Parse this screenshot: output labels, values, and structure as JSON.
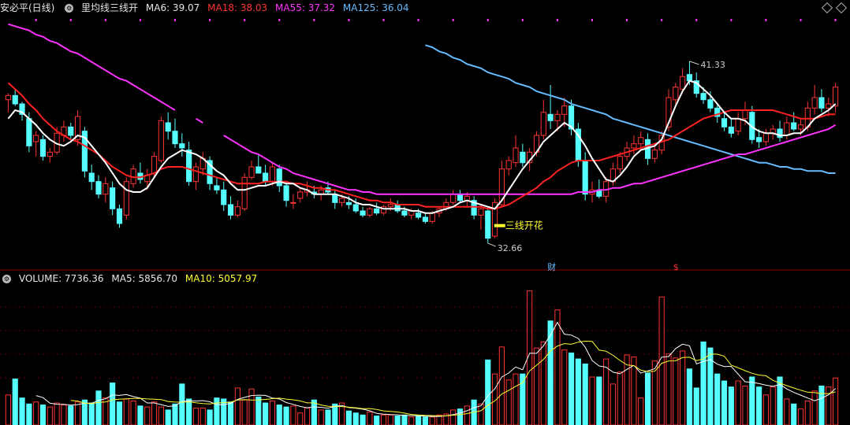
{
  "header": {
    "stock_name": "安必平(日线)",
    "indicator_name": "里均线三线开",
    "ma6": "MA6: 39.07",
    "ma18": "MA18: 38.03",
    "ma55": "MA55: 37.32",
    "ma125": "MA125: 36.04"
  },
  "volume_header": {
    "volume": "VOLUME: 7736.36",
    "ma5": "MA5: 5856.70",
    "ma10": "MA10: 5057.97"
  },
  "annotations": {
    "high_label": "41.33",
    "low_label": "32.66",
    "signal_text": "三线开花",
    "finance_badge": "财",
    "dollar_badge": "$"
  },
  "colors": {
    "up": "#ff3333",
    "down": "#55ffff",
    "ma6": "#ffffff",
    "ma18": "#ff2222",
    "ma55": "#ff33ff",
    "ma125": "#66bbff",
    "vol_ma5": "#ffffff",
    "vol_ma10": "#ffff33"
  },
  "chart_data": {
    "type": "candlestick",
    "price_range": [
      31.5,
      43.5
    ],
    "volume_max": 14000,
    "candles": [
      [
        39.5,
        39.8,
        38.9,
        39.7
      ],
      [
        39.7,
        40.0,
        39.2,
        39.3
      ],
      [
        39.3,
        39.4,
        38.5,
        38.8
      ],
      [
        38.6,
        38.9,
        37.0,
        37.3
      ],
      [
        37.5,
        38.0,
        36.8,
        37.8
      ],
      [
        37.6,
        37.8,
        36.6,
        36.8
      ],
      [
        36.8,
        37.2,
        36.5,
        37.0
      ],
      [
        37.0,
        38.2,
        36.9,
        37.9
      ],
      [
        37.8,
        38.5,
        37.5,
        38.2
      ],
      [
        38.2,
        38.4,
        37.6,
        37.8
      ],
      [
        37.6,
        39.0,
        37.3,
        38.7
      ],
      [
        38.0,
        38.2,
        35.8,
        36.1
      ],
      [
        36.0,
        36.4,
        35.2,
        35.6
      ],
      [
        35.6,
        35.9,
        34.8,
        35.0
      ],
      [
        35.0,
        35.8,
        34.6,
        35.5
      ],
      [
        35.3,
        35.6,
        34.0,
        34.3
      ],
      [
        34.3,
        34.5,
        33.4,
        33.6
      ],
      [
        34.0,
        35.8,
        33.8,
        35.6
      ],
      [
        35.5,
        36.4,
        35.3,
        36.2
      ],
      [
        36.0,
        36.5,
        35.5,
        35.7
      ],
      [
        35.6,
        36.2,
        35.2,
        35.9
      ],
      [
        36.0,
        37.0,
        35.8,
        36.8
      ],
      [
        36.6,
        38.7,
        36.5,
        38.5
      ],
      [
        38.4,
        38.9,
        37.6,
        38.0
      ],
      [
        38.0,
        38.6,
        37.2,
        37.4
      ],
      [
        37.4,
        37.9,
        36.8,
        37.2
      ],
      [
        37.1,
        37.5,
        35.4,
        35.6
      ],
      [
        35.6,
        36.5,
        35.2,
        36.3
      ],
      [
        36.2,
        37.0,
        35.9,
        36.7
      ],
      [
        36.6,
        36.8,
        35.2,
        35.5
      ],
      [
        35.4,
        35.8,
        35.0,
        35.2
      ],
      [
        35.2,
        35.6,
        34.2,
        34.5
      ],
      [
        34.5,
        34.9,
        33.8,
        34.0
      ],
      [
        34.0,
        34.7,
        33.9,
        34.4
      ],
      [
        34.3,
        36.0,
        34.2,
        35.8
      ],
      [
        35.8,
        36.6,
        35.7,
        36.3
      ],
      [
        36.3,
        36.9,
        36.0,
        36.0
      ],
      [
        36.0,
        36.4,
        35.4,
        35.6
      ],
      [
        35.6,
        36.5,
        35.4,
        36.3
      ],
      [
        36.2,
        36.4,
        35.1,
        35.4
      ],
      [
        35.4,
        35.6,
        34.4,
        34.7
      ],
      [
        34.6,
        35.0,
        34.3,
        34.6
      ],
      [
        34.8,
        35.3,
        34.6,
        35.1
      ],
      [
        35.1,
        35.6,
        34.9,
        35.2
      ],
      [
        35.1,
        35.4,
        34.8,
        35.0
      ],
      [
        35.0,
        35.4,
        34.7,
        35.2
      ],
      [
        35.3,
        35.6,
        35.0,
        35.1
      ],
      [
        35.0,
        35.2,
        34.3,
        34.6
      ],
      [
        34.6,
        35.0,
        34.4,
        34.8
      ],
      [
        34.6,
        34.9,
        34.3,
        34.5
      ],
      [
        34.5,
        34.8,
        34.1,
        34.2
      ],
      [
        34.2,
        34.4,
        33.9,
        34.0
      ],
      [
        34.0,
        34.4,
        33.9,
        34.3
      ],
      [
        34.3,
        34.6,
        34.0,
        34.1
      ],
      [
        34.1,
        34.5,
        34.0,
        34.4
      ],
      [
        34.4,
        34.8,
        34.2,
        34.5
      ],
      [
        34.5,
        34.7,
        34.1,
        34.2
      ],
      [
        34.2,
        34.4,
        33.9,
        34.0
      ],
      [
        34.0,
        34.3,
        33.8,
        34.2
      ],
      [
        34.1,
        34.3,
        33.8,
        33.9
      ],
      [
        33.9,
        34.1,
        33.6,
        33.7
      ],
      [
        33.7,
        34.2,
        33.6,
        34.1
      ],
      [
        34.1,
        34.4,
        33.9,
        34.3
      ],
      [
        34.3,
        34.8,
        34.2,
        34.6
      ],
      [
        34.6,
        35.2,
        34.5,
        35.0
      ],
      [
        35.0,
        35.2,
        34.6,
        34.7
      ],
      [
        34.7,
        35.1,
        34.4,
        34.9
      ],
      [
        34.7,
        34.9,
        33.8,
        34.0
      ],
      [
        34.0,
        34.5,
        33.3,
        34.3
      ],
      [
        34.2,
        34.4,
        32.66,
        32.9
      ],
      [
        33.0,
        34.8,
        32.9,
        34.6
      ],
      [
        34.5,
        36.6,
        34.4,
        36.2
      ],
      [
        36.2,
        36.8,
        35.9,
        36.6
      ],
      [
        36.5,
        37.8,
        36.3,
        37.2
      ],
      [
        37.0,
        37.4,
        36.3,
        36.5
      ],
      [
        36.5,
        37.2,
        36.1,
        37.0
      ],
      [
        37.0,
        38.0,
        36.8,
        37.8
      ],
      [
        37.8,
        39.5,
        37.6,
        38.9
      ],
      [
        38.8,
        40.2,
        38.1,
        38.5
      ],
      [
        38.5,
        39.0,
        38.0,
        38.8
      ],
      [
        38.8,
        39.6,
        38.2,
        39.2
      ],
      [
        39.2,
        39.5,
        37.8,
        38.1
      ],
      [
        38.1,
        38.4,
        36.3,
        36.6
      ],
      [
        36.6,
        37.0,
        34.7,
        35.0
      ],
      [
        35.0,
        35.6,
        34.6,
        35.2
      ],
      [
        35.2,
        35.7,
        34.8,
        34.9
      ],
      [
        34.9,
        35.8,
        34.6,
        35.6
      ],
      [
        35.6,
        36.5,
        35.4,
        36.2
      ],
      [
        36.2,
        37.0,
        36.0,
        36.8
      ],
      [
        36.8,
        37.5,
        36.6,
        37.2
      ],
      [
        37.2,
        37.8,
        36.9,
        37.4
      ],
      [
        37.4,
        38.0,
        37.1,
        37.7
      ],
      [
        37.6,
        37.9,
        36.4,
        36.7
      ],
      [
        36.7,
        37.3,
        36.5,
        37.1
      ],
      [
        37.1,
        38.0,
        36.9,
        37.8
      ],
      [
        38.2,
        40.0,
        38.0,
        39.6
      ],
      [
        39.5,
        40.3,
        39.3,
        40.1
      ],
      [
        40.0,
        41.0,
        39.8,
        40.6
      ],
      [
        40.7,
        41.33,
        40.2,
        40.4
      ],
      [
        40.4,
        40.8,
        39.6,
        39.8
      ],
      [
        39.8,
        40.1,
        39.3,
        39.5
      ],
      [
        39.5,
        39.9,
        38.9,
        39.1
      ],
      [
        39.1,
        39.3,
        38.4,
        38.7
      ],
      [
        38.6,
        38.9,
        38.0,
        38.2
      ],
      [
        38.2,
        38.6,
        37.7,
        37.9
      ],
      [
        38.0,
        38.9,
        37.8,
        38.6
      ],
      [
        38.6,
        39.4,
        38.3,
        39.0
      ],
      [
        38.9,
        39.2,
        37.4,
        37.6
      ],
      [
        37.7,
        38.1,
        37.2,
        37.5
      ],
      [
        37.5,
        38.1,
        37.3,
        37.9
      ],
      [
        37.9,
        38.3,
        37.6,
        38.1
      ],
      [
        38.1,
        38.5,
        37.5,
        37.7
      ],
      [
        37.8,
        38.7,
        37.6,
        38.4
      ],
      [
        38.4,
        38.9,
        38.0,
        38.1
      ],
      [
        38.1,
        38.6,
        37.8,
        38.3
      ],
      [
        38.2,
        39.4,
        38.0,
        39.1
      ],
      [
        39.1,
        40.2,
        38.8,
        39.6
      ],
      [
        39.6,
        40.0,
        38.9,
        39.1
      ],
      [
        39.1,
        39.6,
        38.7,
        39.3
      ],
      [
        39.2,
        40.3,
        38.9,
        40.1
      ]
    ],
    "ma6": [
      38.6,
      39.0,
      38.9,
      38.6,
      38.3,
      37.9,
      37.6,
      37.4,
      37.3,
      37.5,
      37.8,
      37.7,
      37.3,
      36.9,
      36.5,
      36.0,
      35.5,
      35.2,
      35.1,
      35.1,
      35.3,
      35.8,
      36.3,
      36.7,
      36.9,
      37.1,
      37.0,
      36.9,
      36.7,
      36.4,
      36.1,
      35.9,
      35.5,
      35.2,
      35.2,
      35.3,
      35.4,
      35.4,
      35.5,
      35.6,
      35.5,
      35.5,
      35.3,
      35.2,
      35.0,
      35.0,
      35.0,
      35.0,
      34.9,
      34.8,
      34.6,
      34.5,
      34.5,
      34.4,
      34.3,
      34.3,
      34.3,
      34.3,
      34.2,
      34.2,
      34.1,
      34.1,
      34.2,
      34.3,
      34.4,
      34.6,
      34.7,
      34.6,
      34.5,
      34.4,
      34.3,
      34.7,
      35.2,
      35.7,
      36.2,
      36.6,
      37.0,
      37.5,
      37.8,
      38.1,
      38.4,
      38.2,
      37.8,
      37.3,
      36.7,
      36.2,
      35.7,
      35.6,
      35.9,
      36.3,
      36.8,
      37.1,
      37.2,
      37.3,
      37.6,
      38.4,
      39.2,
      39.9,
      40.4,
      40.3,
      40.0,
      39.7,
      39.3,
      38.9,
      38.6,
      38.6,
      38.5,
      38.2,
      38.0,
      37.9,
      37.9,
      37.8,
      37.8,
      37.9,
      37.9,
      38.2,
      38.6,
      38.8,
      39.0,
      39.3
    ],
    "ma18": [
      40.3,
      40.0,
      39.7,
      39.3,
      39.0,
      38.6,
      38.3,
      38.0,
      37.8,
      37.6,
      37.5,
      37.3,
      37.1,
      36.9,
      36.6,
      36.3,
      36.1,
      35.9,
      35.8,
      35.8,
      35.9,
      36.0,
      36.2,
      36.3,
      36.3,
      36.3,
      36.2,
      36.1,
      36.0,
      35.9,
      35.8,
      35.7,
      35.6,
      35.5,
      35.5,
      35.5,
      35.5,
      35.6,
      35.6,
      35.6,
      35.6,
      35.5,
      35.5,
      35.4,
      35.3,
      35.3,
      35.2,
      35.2,
      35.1,
      35.0,
      34.9,
      34.8,
      34.7,
      34.7,
      34.6,
      34.6,
      34.5,
      34.5,
      34.5,
      34.5,
      34.4,
      34.4,
      34.4,
      34.4,
      34.4,
      34.4,
      34.4,
      34.4,
      34.4,
      34.3,
      34.3,
      34.4,
      34.5,
      34.7,
      34.9,
      35.1,
      35.3,
      35.6,
      35.8,
      36.1,
      36.3,
      36.5,
      36.6,
      36.6,
      36.6,
      36.6,
      36.7,
      36.8,
      36.9,
      37.0,
      37.1,
      37.2,
      37.3,
      37.4,
      37.5,
      37.6,
      37.8,
      38.0,
      38.2,
      38.4,
      38.6,
      38.7,
      38.8,
      38.9,
      39.0,
      39.0,
      39.0,
      39.0,
      39.0,
      39.0,
      39.0,
      38.9,
      38.8,
      38.7,
      38.6,
      38.6,
      38.6,
      38.7,
      38.8,
      38.8
    ],
    "ma55": [
      43.1,
      43.0,
      42.9,
      42.8,
      42.6,
      42.5,
      42.3,
      42.2,
      42.0,
      41.8,
      41.7,
      41.5,
      41.3,
      41.1,
      40.9,
      40.7,
      40.5,
      40.4,
      40.2,
      40.0,
      39.8,
      39.6,
      39.4,
      39.2,
      39.0,
      null,
      null,
      38.6,
      38.4,
      null,
      null,
      37.8,
      37.6,
      37.4,
      37.2,
      37.0,
      36.9,
      36.7,
      36.5,
      36.3,
      36.2,
      36.0,
      35.9,
      35.8,
      35.7,
      35.6,
      35.5,
      35.4,
      35.3,
      35.2,
      35.2,
      35.1,
      35.1,
      35.0,
      35.0,
      35.0,
      35.0,
      35.0,
      35.0,
      35.0,
      35.0,
      35.0,
      35.0,
      35.0,
      35.0,
      35.0,
      35.0,
      35.0,
      35.0,
      35.0,
      35.0,
      35.0,
      35.0,
      35.0,
      35.0,
      35.0,
      35.0,
      35.0,
      35.0,
      35.0,
      35.0,
      35.0,
      35.1,
      35.1,
      35.1,
      35.2,
      35.2,
      35.3,
      35.3,
      35.4,
      35.5,
      35.5,
      35.6,
      35.7,
      35.8,
      35.9,
      36.0,
      36.1,
      36.2,
      36.3,
      36.4,
      36.5,
      36.6,
      36.7,
      36.8,
      36.9,
      36.9,
      37.0,
      37.1,
      37.2,
      37.3,
      37.4,
      37.5,
      37.6,
      37.7,
      37.8,
      37.9,
      38.0,
      38.1,
      38.3
    ],
    "ma125": [
      null,
      null,
      null,
      null,
      null,
      null,
      null,
      null,
      null,
      null,
      null,
      null,
      null,
      null,
      null,
      null,
      null,
      null,
      null,
      null,
      null,
      null,
      null,
      null,
      null,
      null,
      null,
      null,
      null,
      null,
      null,
      null,
      null,
      null,
      null,
      null,
      null,
      null,
      null,
      null,
      null,
      null,
      null,
      null,
      null,
      null,
      null,
      null,
      null,
      null,
      null,
      null,
      null,
      null,
      null,
      null,
      null,
      null,
      null,
      null,
      42.1,
      42.0,
      41.8,
      41.7,
      41.5,
      41.4,
      41.2,
      41.1,
      41.0,
      40.8,
      40.7,
      40.6,
      40.5,
      40.3,
      40.2,
      40.1,
      39.9,
      39.8,
      39.7,
      39.6,
      39.5,
      39.3,
      39.2,
      39.1,
      39.0,
      38.9,
      38.8,
      38.6,
      38.5,
      38.4,
      38.3,
      38.2,
      38.1,
      38.0,
      37.9,
      37.8,
      37.7,
      37.6,
      37.5,
      37.4,
      37.3,
      37.2,
      37.1,
      37.0,
      36.9,
      36.8,
      36.7,
      36.6,
      36.5,
      36.5,
      36.4,
      36.3,
      36.3,
      36.2,
      36.2,
      36.1,
      36.1,
      36.1,
      36.0,
      36.0
    ],
    "volume": [
      3000,
      4600,
      2700,
      2100,
      2300,
      2000,
      1800,
      2200,
      2000,
      1900,
      2300,
      2500,
      2200,
      3400,
      2700,
      4200,
      2300,
      2600,
      2400,
      1900,
      1800,
      2300,
      1800,
      1500,
      2100,
      4100,
      2600,
      1700,
      1700,
      1500,
      2700,
      2600,
      2300,
      3700,
      2500,
      3600,
      2800,
      2200,
      2400,
      2000,
      1800,
      1900,
      1200,
      1700,
      2500,
      1500,
      1500,
      2100,
      2200,
      1400,
      1200,
      1000,
      1300,
      900,
      1000,
      1000,
      900,
      1000,
      800,
      900,
      800,
      800,
      1000,
      1100,
      1500,
      1600,
      1900,
      2500,
      2100,
      6500,
      5100,
      7800,
      4500,
      5100,
      5100,
      13400,
      7700,
      8300,
      10400,
      11500,
      7500,
      7200,
      6600,
      6100,
      4800,
      4800,
      6600,
      4100,
      5300,
      7000,
      6800,
      2700,
      5200,
      6400,
      12800,
      7100,
      6700,
      7400,
      5600,
      3700,
      8300,
      7700,
      5100,
      4400,
      3800,
      4400,
      3900,
      4800,
      3800,
      3000,
      3800,
      4800,
      2600,
      2100,
      1600,
      2400,
      3400,
      3900,
      3800,
      4700
    ]
  }
}
